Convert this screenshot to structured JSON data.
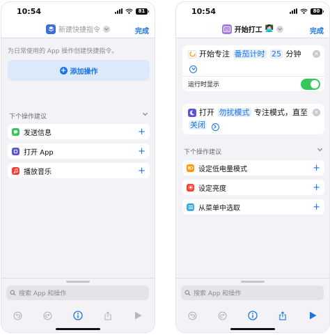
{
  "status": {
    "time": "10:54",
    "battery_left": "81",
    "battery_right": "80"
  },
  "left": {
    "title": "新建快捷指令",
    "done_label": "完成",
    "hint": "为日常使用的 App 操作创建快捷指令。",
    "add_action_label": "添加操作",
    "section_label": "下个操作建议",
    "suggestions": [
      {
        "label": "发送信息",
        "icon": "message-icon",
        "color": "#34c759"
      },
      {
        "label": "打开 App",
        "icon": "open-app-icon",
        "color": "#5856d6"
      },
      {
        "label": "播放音乐",
        "icon": "music-icon",
        "color": "#ff3b30"
      }
    ],
    "search_placeholder": "搜索 App 和操作"
  },
  "right": {
    "title": "开始打工",
    "title_emoji": "👩🏻‍💻",
    "done_label": "完成",
    "card1": {
      "prefix": "开始专注",
      "token_timer": "番茄计时",
      "token_duration": "25",
      "unit": "分钟",
      "toggle_label": "运行时显示",
      "toggle_on": true
    },
    "card2": {
      "prefix": "打开",
      "token_mode": "勿扰模式",
      "middle": "专注模式，直至",
      "token_until": "关闭"
    },
    "section_label": "下个操作建议",
    "suggestions": [
      {
        "label": "设定低电量模式",
        "icon": "battery-icon",
        "color": "#ff9500"
      },
      {
        "label": "设定亮度",
        "icon": "brightness-icon",
        "color": "#ff3b30"
      },
      {
        "label": "从菜单中选取",
        "icon": "menu-list-icon",
        "color": "#32ade6"
      }
    ],
    "search_placeholder": "搜索 App 和操作"
  },
  "colors": {
    "accent": "#1a73e8",
    "toggle_on": "#34c759"
  }
}
